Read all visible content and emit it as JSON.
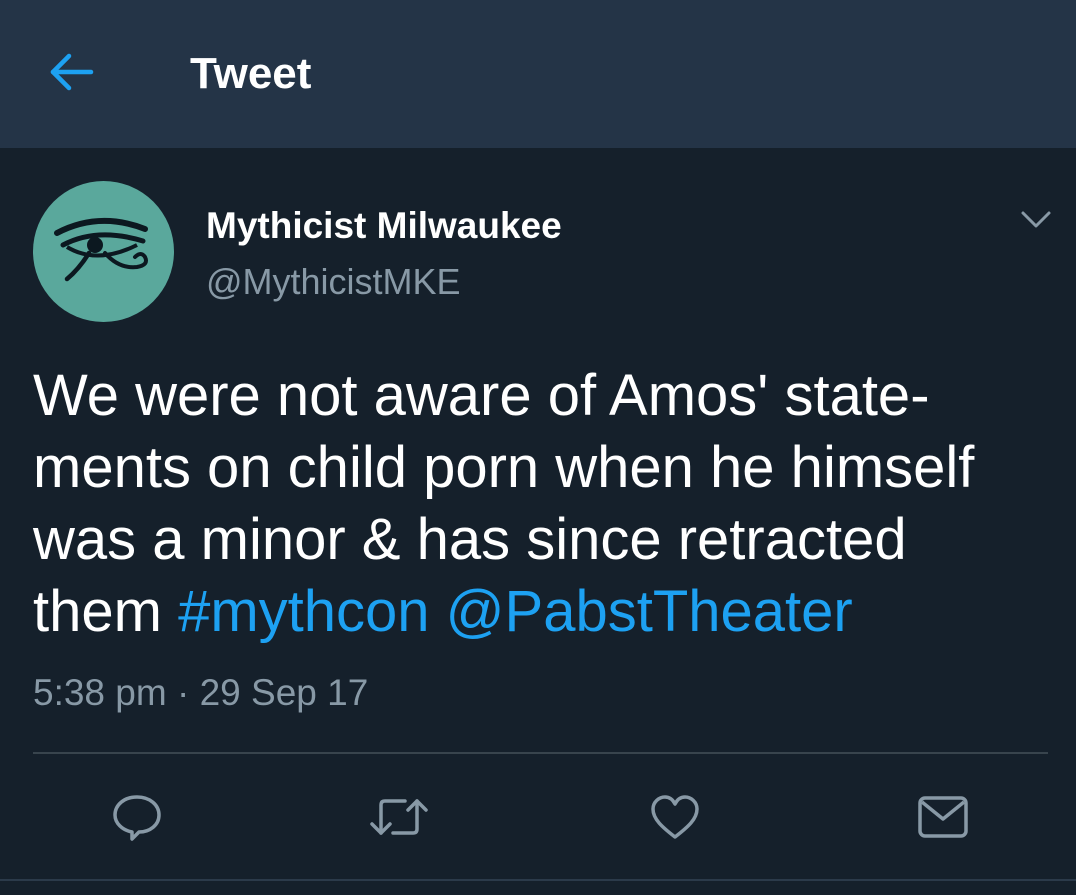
{
  "header": {
    "title": "Tweet",
    "back_icon": "arrow-left-icon"
  },
  "tweet": {
    "author": {
      "name": "Mythicist Milwaukee",
      "handle": "@MythicistMKE",
      "avatar_icon": "eye-of-horus-icon"
    },
    "text_lines": [
      "We were not aware of Amos' state-",
      "ments on child porn when he himself",
      "was a minor & has since retracted",
      "them "
    ],
    "hashtag": "#mythcon",
    "mention": "@PabstTheater",
    "time": "5:38 pm",
    "separator": "·",
    "date": "29 Sep 17"
  },
  "actions": [
    {
      "name": "reply",
      "icon": "reply-icon"
    },
    {
      "name": "retweet",
      "icon": "retweet-icon"
    },
    {
      "name": "like",
      "icon": "heart-icon"
    },
    {
      "name": "share",
      "icon": "mail-icon"
    }
  ],
  "colors": {
    "background": "#15202b",
    "header": "#243447",
    "accent": "#1da1f2",
    "secondary_text": "#8899a6",
    "avatar": "#5aa89c"
  }
}
